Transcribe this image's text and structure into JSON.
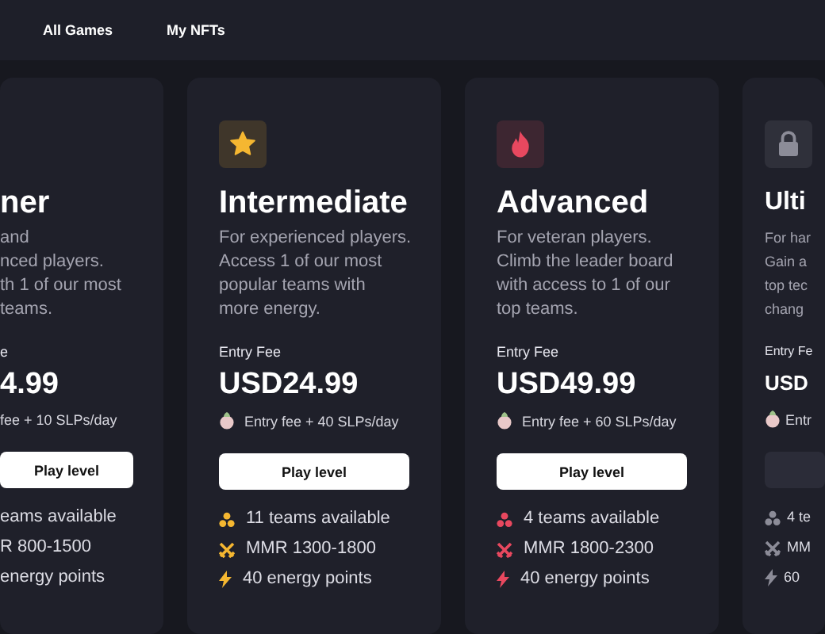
{
  "nav": [
    {
      "label": "All Games"
    },
    {
      "label": "My NFTs"
    }
  ],
  "cards": [
    {
      "kind": "partial-left",
      "title": "ner",
      "description": "and\nnced players.\nth 1 of our most\nteams.",
      "fee_label": "e",
      "price": "4.99",
      "reward": "fee + 10 SLPs/day",
      "button": {
        "label": "Play level",
        "disabled": false
      },
      "features": [
        {
          "text": "eams available"
        },
        {
          "text": "R 800-1500"
        },
        {
          "text": "energy points"
        }
      ]
    },
    {
      "kind": "full",
      "color": "#f5b731",
      "title": "Intermediate",
      "description": "For experienced players.\nAccess 1 of our most\npopular teams with\nmore energy.",
      "fee_label": "Entry Fee",
      "price": "USD24.99",
      "reward": "Entry fee + 40 SLPs/day",
      "button": {
        "label": "Play level",
        "disabled": false
      },
      "features": [
        {
          "kind": "teams",
          "text": "11 teams available"
        },
        {
          "kind": "mmr",
          "text": "MMR 1300-1800"
        },
        {
          "kind": "energy",
          "text": "40 energy points"
        }
      ]
    },
    {
      "kind": "full",
      "color": "#e8485f",
      "title": "Advanced",
      "description": "For veteran players.\nClimb the leader board\nwith access to 1 of our\ntop teams.",
      "fee_label": "Entry Fee",
      "price": "USD49.99",
      "reward": "Entry fee + 60 SLPs/day",
      "button": {
        "label": "Play level",
        "disabled": false
      },
      "features": [
        {
          "kind": "teams",
          "text": "4 teams available"
        },
        {
          "kind": "mmr",
          "text": "MMR 1800-2300"
        },
        {
          "kind": "energy",
          "text": "40 energy points"
        }
      ]
    },
    {
      "kind": "partial-right",
      "color": "#8c8c98",
      "title": "Ulti",
      "description": "For har\nGain a\ntop tec\nchang",
      "fee_label": "Entry Fe",
      "price": "USD",
      "reward": "Entr",
      "button": {
        "disabled": true
      },
      "features": [
        {
          "kind": "teams",
          "text": "4 te"
        },
        {
          "kind": "mmr",
          "text": "MM"
        },
        {
          "kind": "energy",
          "text": "60"
        }
      ]
    }
  ]
}
